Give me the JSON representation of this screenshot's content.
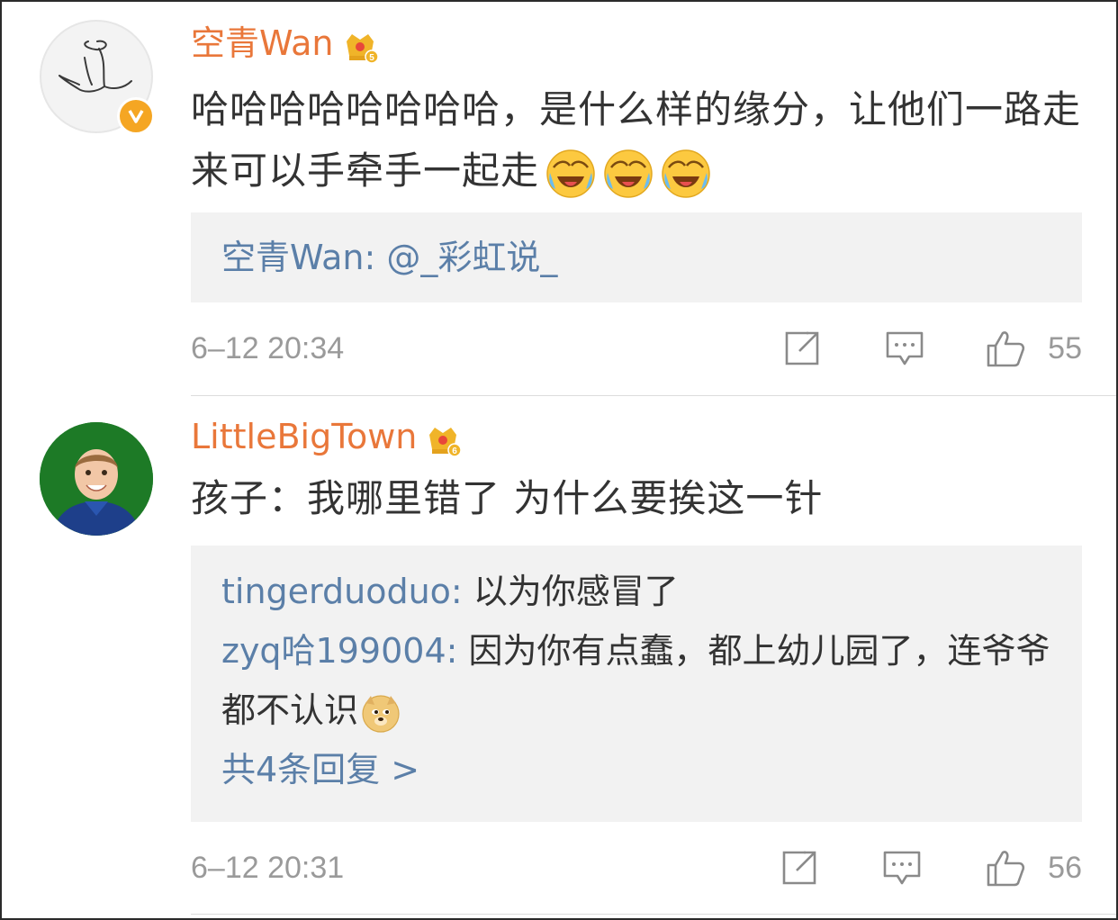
{
  "comments": [
    {
      "username": "空青Wan",
      "crown_level": "5",
      "content_text": "哈哈哈哈哈哈哈哈，是什么样的缘分，让他们一路走来可以手牵手一起走",
      "emojis": [
        "laugh-cry-emoji",
        "laugh-cry-emoji",
        "laugh-cry-emoji"
      ],
      "verified": true,
      "replies": [
        {
          "name": "空青Wan",
          "sep": ": ",
          "text": "@_彩虹说_"
        }
      ],
      "more_replies": "",
      "time": "6–12 20:34",
      "likes": "55"
    },
    {
      "username": "LittleBigTown",
      "crown_level": "6",
      "content_text": "孩子：我哪里错了 为什么要挨这一针",
      "verified": false,
      "replies": [
        {
          "name": "tingerduoduo",
          "sep": ": ",
          "text": "以为你感冒了"
        },
        {
          "name": "zyq哈199004",
          "sep": ": ",
          "text": "因为你有点蠢，都上幼儿园了，连爷爷都不认识"
        }
      ],
      "more_replies": "共4条回复 >",
      "time": "6–12 20:31",
      "likes": "56"
    }
  ],
  "colors": {
    "username": "#e9773a",
    "reply_name": "#5b7fa8",
    "text": "#333333",
    "meta": "#9a9a9a",
    "reply_bg": "#f2f2f2",
    "verified_badge": "#f5a623"
  }
}
